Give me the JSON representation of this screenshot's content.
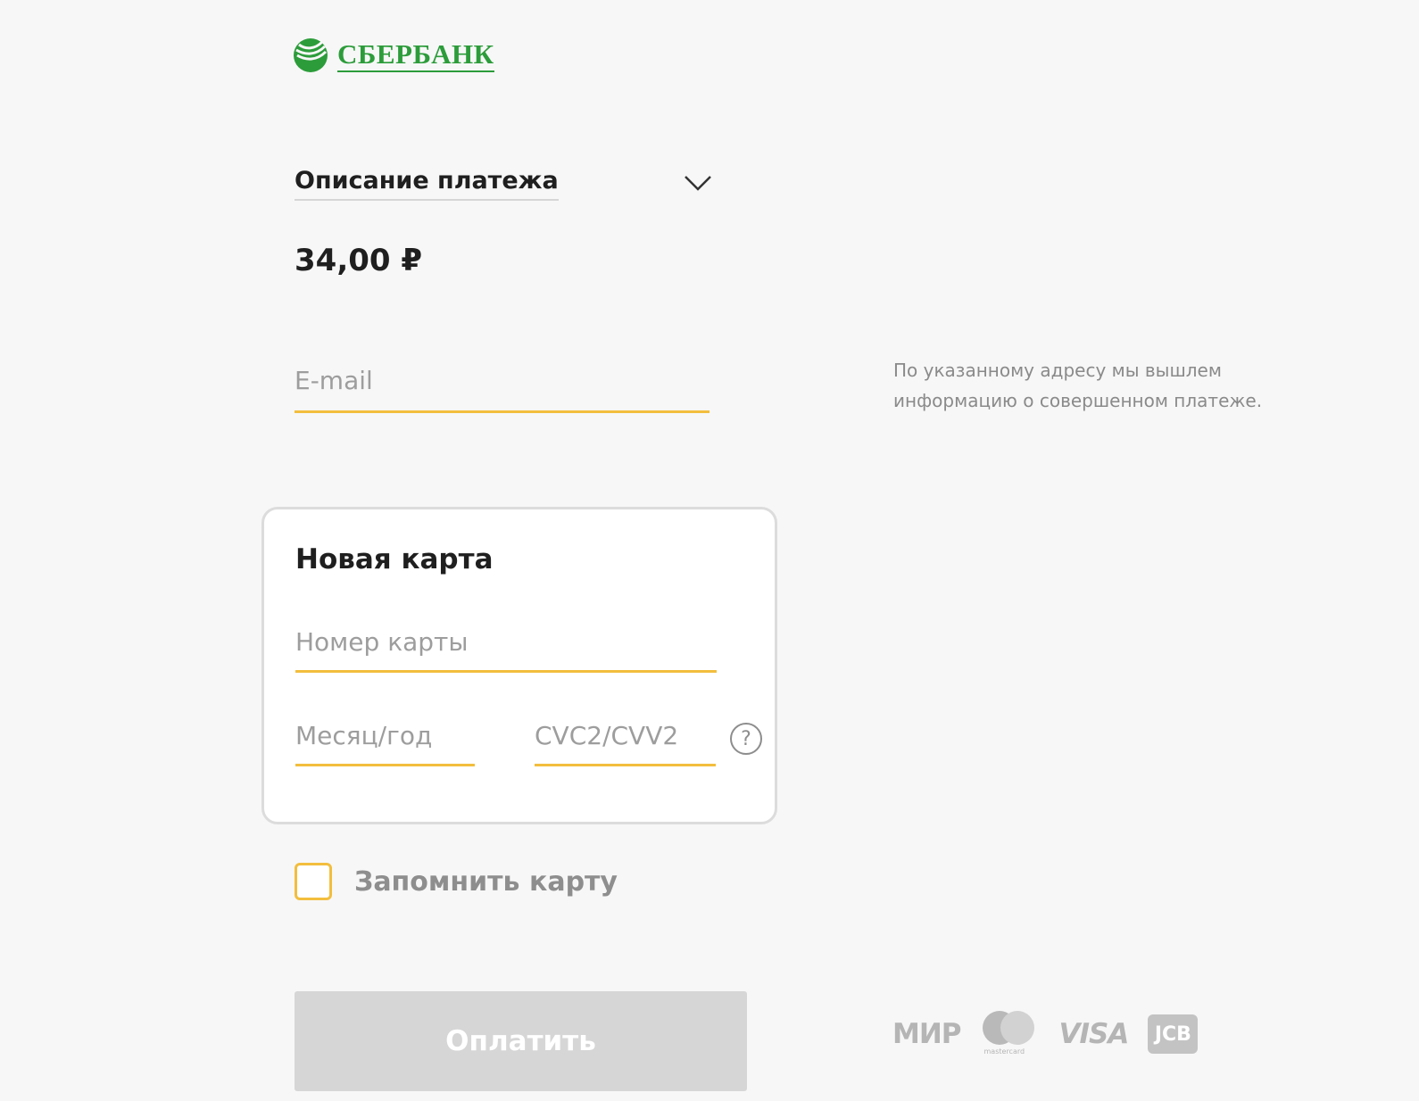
{
  "brand": {
    "name": "СБЕРБАНК",
    "color": "#2c9c3a"
  },
  "payment": {
    "description_label": "Описание платежа",
    "amount": "34,00 ₽"
  },
  "email": {
    "placeholder": "E-mail",
    "note": "По указанному адресу мы вышлем информацию о совершенном платеже."
  },
  "card": {
    "title": "Новая карта",
    "number_placeholder": "Номер карты",
    "expiry_placeholder": "Месяц/год",
    "cvc_placeholder": "CVC2/CVV2",
    "help_symbol": "?"
  },
  "remember": {
    "label": "Запомнить карту",
    "checked": false
  },
  "pay_button": {
    "label": "Оплатить"
  },
  "payment_systems": {
    "mir": "МИР",
    "mastercard": "mastercard",
    "visa": "VISA",
    "jcb": "JCB"
  },
  "colors": {
    "accent": "#f2be3d",
    "button_disabled": "#d6d6d6",
    "background": "#f7f7f7"
  }
}
